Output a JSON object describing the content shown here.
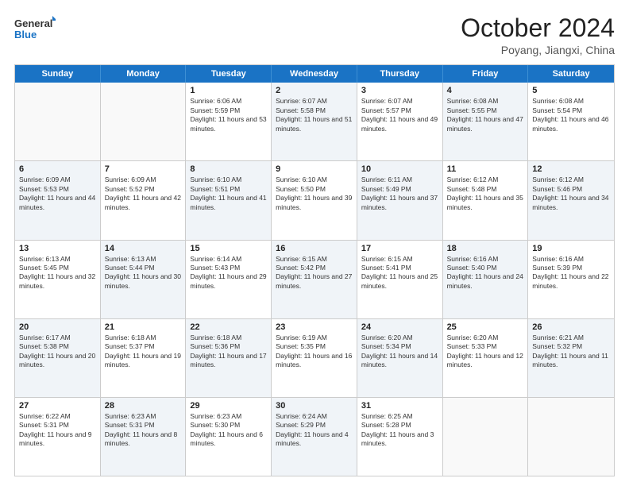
{
  "logo": {
    "line1": "General",
    "line2": "Blue"
  },
  "title": "October 2024",
  "location": "Poyang, Jiangxi, China",
  "days_of_week": [
    "Sunday",
    "Monday",
    "Tuesday",
    "Wednesday",
    "Thursday",
    "Friday",
    "Saturday"
  ],
  "weeks": [
    [
      {
        "day": "",
        "sunrise": "",
        "sunset": "",
        "daylight": "",
        "shaded": false,
        "empty": true
      },
      {
        "day": "",
        "sunrise": "",
        "sunset": "",
        "daylight": "",
        "shaded": false,
        "empty": true
      },
      {
        "day": "1",
        "sunrise": "Sunrise: 6:06 AM",
        "sunset": "Sunset: 5:59 PM",
        "daylight": "Daylight: 11 hours and 53 minutes.",
        "shaded": false,
        "empty": false
      },
      {
        "day": "2",
        "sunrise": "Sunrise: 6:07 AM",
        "sunset": "Sunset: 5:58 PM",
        "daylight": "Daylight: 11 hours and 51 minutes.",
        "shaded": true,
        "empty": false
      },
      {
        "day": "3",
        "sunrise": "Sunrise: 6:07 AM",
        "sunset": "Sunset: 5:57 PM",
        "daylight": "Daylight: 11 hours and 49 minutes.",
        "shaded": false,
        "empty": false
      },
      {
        "day": "4",
        "sunrise": "Sunrise: 6:08 AM",
        "sunset": "Sunset: 5:55 PM",
        "daylight": "Daylight: 11 hours and 47 minutes.",
        "shaded": true,
        "empty": false
      },
      {
        "day": "5",
        "sunrise": "Sunrise: 6:08 AM",
        "sunset": "Sunset: 5:54 PM",
        "daylight": "Daylight: 11 hours and 46 minutes.",
        "shaded": false,
        "empty": false
      }
    ],
    [
      {
        "day": "6",
        "sunrise": "Sunrise: 6:09 AM",
        "sunset": "Sunset: 5:53 PM",
        "daylight": "Daylight: 11 hours and 44 minutes.",
        "shaded": true,
        "empty": false
      },
      {
        "day": "7",
        "sunrise": "Sunrise: 6:09 AM",
        "sunset": "Sunset: 5:52 PM",
        "daylight": "Daylight: 11 hours and 42 minutes.",
        "shaded": false,
        "empty": false
      },
      {
        "day": "8",
        "sunrise": "Sunrise: 6:10 AM",
        "sunset": "Sunset: 5:51 PM",
        "daylight": "Daylight: 11 hours and 41 minutes.",
        "shaded": true,
        "empty": false
      },
      {
        "day": "9",
        "sunrise": "Sunrise: 6:10 AM",
        "sunset": "Sunset: 5:50 PM",
        "daylight": "Daylight: 11 hours and 39 minutes.",
        "shaded": false,
        "empty": false
      },
      {
        "day": "10",
        "sunrise": "Sunrise: 6:11 AM",
        "sunset": "Sunset: 5:49 PM",
        "daylight": "Daylight: 11 hours and 37 minutes.",
        "shaded": true,
        "empty": false
      },
      {
        "day": "11",
        "sunrise": "Sunrise: 6:12 AM",
        "sunset": "Sunset: 5:48 PM",
        "daylight": "Daylight: 11 hours and 35 minutes.",
        "shaded": false,
        "empty": false
      },
      {
        "day": "12",
        "sunrise": "Sunrise: 6:12 AM",
        "sunset": "Sunset: 5:46 PM",
        "daylight": "Daylight: 11 hours and 34 minutes.",
        "shaded": true,
        "empty": false
      }
    ],
    [
      {
        "day": "13",
        "sunrise": "Sunrise: 6:13 AM",
        "sunset": "Sunset: 5:45 PM",
        "daylight": "Daylight: 11 hours and 32 minutes.",
        "shaded": false,
        "empty": false
      },
      {
        "day": "14",
        "sunrise": "Sunrise: 6:13 AM",
        "sunset": "Sunset: 5:44 PM",
        "daylight": "Daylight: 11 hours and 30 minutes.",
        "shaded": true,
        "empty": false
      },
      {
        "day": "15",
        "sunrise": "Sunrise: 6:14 AM",
        "sunset": "Sunset: 5:43 PM",
        "daylight": "Daylight: 11 hours and 29 minutes.",
        "shaded": false,
        "empty": false
      },
      {
        "day": "16",
        "sunrise": "Sunrise: 6:15 AM",
        "sunset": "Sunset: 5:42 PM",
        "daylight": "Daylight: 11 hours and 27 minutes.",
        "shaded": true,
        "empty": false
      },
      {
        "day": "17",
        "sunrise": "Sunrise: 6:15 AM",
        "sunset": "Sunset: 5:41 PM",
        "daylight": "Daylight: 11 hours and 25 minutes.",
        "shaded": false,
        "empty": false
      },
      {
        "day": "18",
        "sunrise": "Sunrise: 6:16 AM",
        "sunset": "Sunset: 5:40 PM",
        "daylight": "Daylight: 11 hours and 24 minutes.",
        "shaded": true,
        "empty": false
      },
      {
        "day": "19",
        "sunrise": "Sunrise: 6:16 AM",
        "sunset": "Sunset: 5:39 PM",
        "daylight": "Daylight: 11 hours and 22 minutes.",
        "shaded": false,
        "empty": false
      }
    ],
    [
      {
        "day": "20",
        "sunrise": "Sunrise: 6:17 AM",
        "sunset": "Sunset: 5:38 PM",
        "daylight": "Daylight: 11 hours and 20 minutes.",
        "shaded": true,
        "empty": false
      },
      {
        "day": "21",
        "sunrise": "Sunrise: 6:18 AM",
        "sunset": "Sunset: 5:37 PM",
        "daylight": "Daylight: 11 hours and 19 minutes.",
        "shaded": false,
        "empty": false
      },
      {
        "day": "22",
        "sunrise": "Sunrise: 6:18 AM",
        "sunset": "Sunset: 5:36 PM",
        "daylight": "Daylight: 11 hours and 17 minutes.",
        "shaded": true,
        "empty": false
      },
      {
        "day": "23",
        "sunrise": "Sunrise: 6:19 AM",
        "sunset": "Sunset: 5:35 PM",
        "daylight": "Daylight: 11 hours and 16 minutes.",
        "shaded": false,
        "empty": false
      },
      {
        "day": "24",
        "sunrise": "Sunrise: 6:20 AM",
        "sunset": "Sunset: 5:34 PM",
        "daylight": "Daylight: 11 hours and 14 minutes.",
        "shaded": true,
        "empty": false
      },
      {
        "day": "25",
        "sunrise": "Sunrise: 6:20 AM",
        "sunset": "Sunset: 5:33 PM",
        "daylight": "Daylight: 11 hours and 12 minutes.",
        "shaded": false,
        "empty": false
      },
      {
        "day": "26",
        "sunrise": "Sunrise: 6:21 AM",
        "sunset": "Sunset: 5:32 PM",
        "daylight": "Daylight: 11 hours and 11 minutes.",
        "shaded": true,
        "empty": false
      }
    ],
    [
      {
        "day": "27",
        "sunrise": "Sunrise: 6:22 AM",
        "sunset": "Sunset: 5:31 PM",
        "daylight": "Daylight: 11 hours and 9 minutes.",
        "shaded": false,
        "empty": false
      },
      {
        "day": "28",
        "sunrise": "Sunrise: 6:23 AM",
        "sunset": "Sunset: 5:31 PM",
        "daylight": "Daylight: 11 hours and 8 minutes.",
        "shaded": true,
        "empty": false
      },
      {
        "day": "29",
        "sunrise": "Sunrise: 6:23 AM",
        "sunset": "Sunset: 5:30 PM",
        "daylight": "Daylight: 11 hours and 6 minutes.",
        "shaded": false,
        "empty": false
      },
      {
        "day": "30",
        "sunrise": "Sunrise: 6:24 AM",
        "sunset": "Sunset: 5:29 PM",
        "daylight": "Daylight: 11 hours and 4 minutes.",
        "shaded": true,
        "empty": false
      },
      {
        "day": "31",
        "sunrise": "Sunrise: 6:25 AM",
        "sunset": "Sunset: 5:28 PM",
        "daylight": "Daylight: 11 hours and 3 minutes.",
        "shaded": false,
        "empty": false
      },
      {
        "day": "",
        "sunrise": "",
        "sunset": "",
        "daylight": "",
        "shaded": true,
        "empty": true
      },
      {
        "day": "",
        "sunrise": "",
        "sunset": "",
        "daylight": "",
        "shaded": false,
        "empty": true
      }
    ]
  ]
}
